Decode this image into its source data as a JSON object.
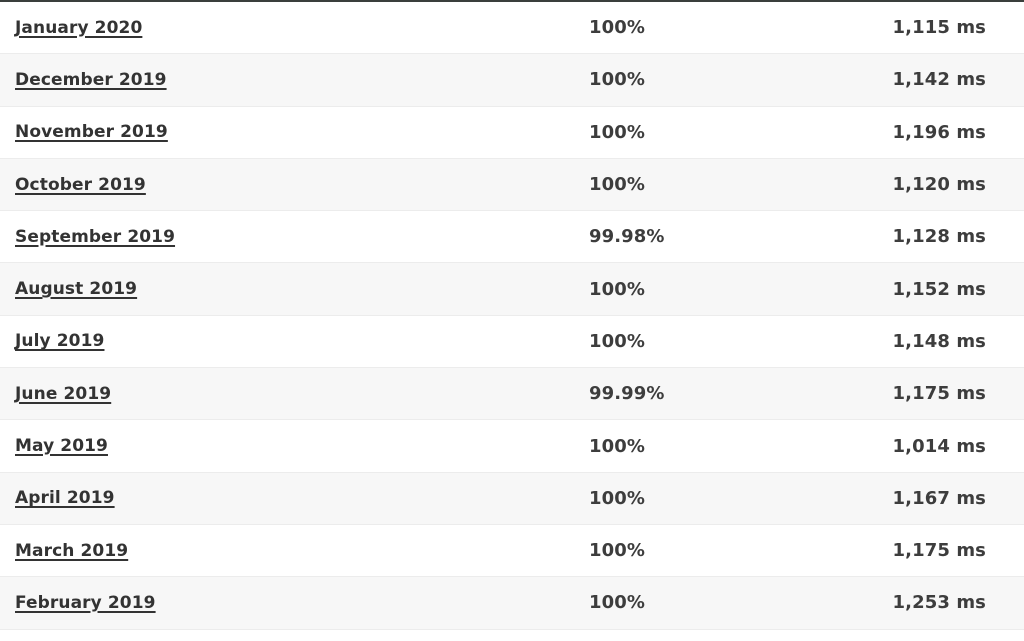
{
  "table": {
    "rows": [
      {
        "month": "January 2020",
        "uptime": "100%",
        "response_time": "1,115 ms"
      },
      {
        "month": "December 2019",
        "uptime": "100%",
        "response_time": "1,142 ms"
      },
      {
        "month": "November 2019",
        "uptime": "100%",
        "response_time": "1,196 ms"
      },
      {
        "month": "October 2019",
        "uptime": "100%",
        "response_time": "1,120 ms"
      },
      {
        "month": "September 2019",
        "uptime": "99.98%",
        "response_time": "1,128 ms"
      },
      {
        "month": "August 2019",
        "uptime": "100%",
        "response_time": "1,152 ms"
      },
      {
        "month": "July 2019",
        "uptime": "100%",
        "response_time": "1,148 ms"
      },
      {
        "month": "June 2019",
        "uptime": "99.99%",
        "response_time": "1,175 ms"
      },
      {
        "month": "May 2019",
        "uptime": "100%",
        "response_time": "1,014 ms"
      },
      {
        "month": "April 2019",
        "uptime": "100%",
        "response_time": "1,167 ms"
      },
      {
        "month": "March 2019",
        "uptime": "100%",
        "response_time": "1,175 ms"
      },
      {
        "month": "February 2019",
        "uptime": "100%",
        "response_time": "1,253 ms"
      }
    ]
  }
}
